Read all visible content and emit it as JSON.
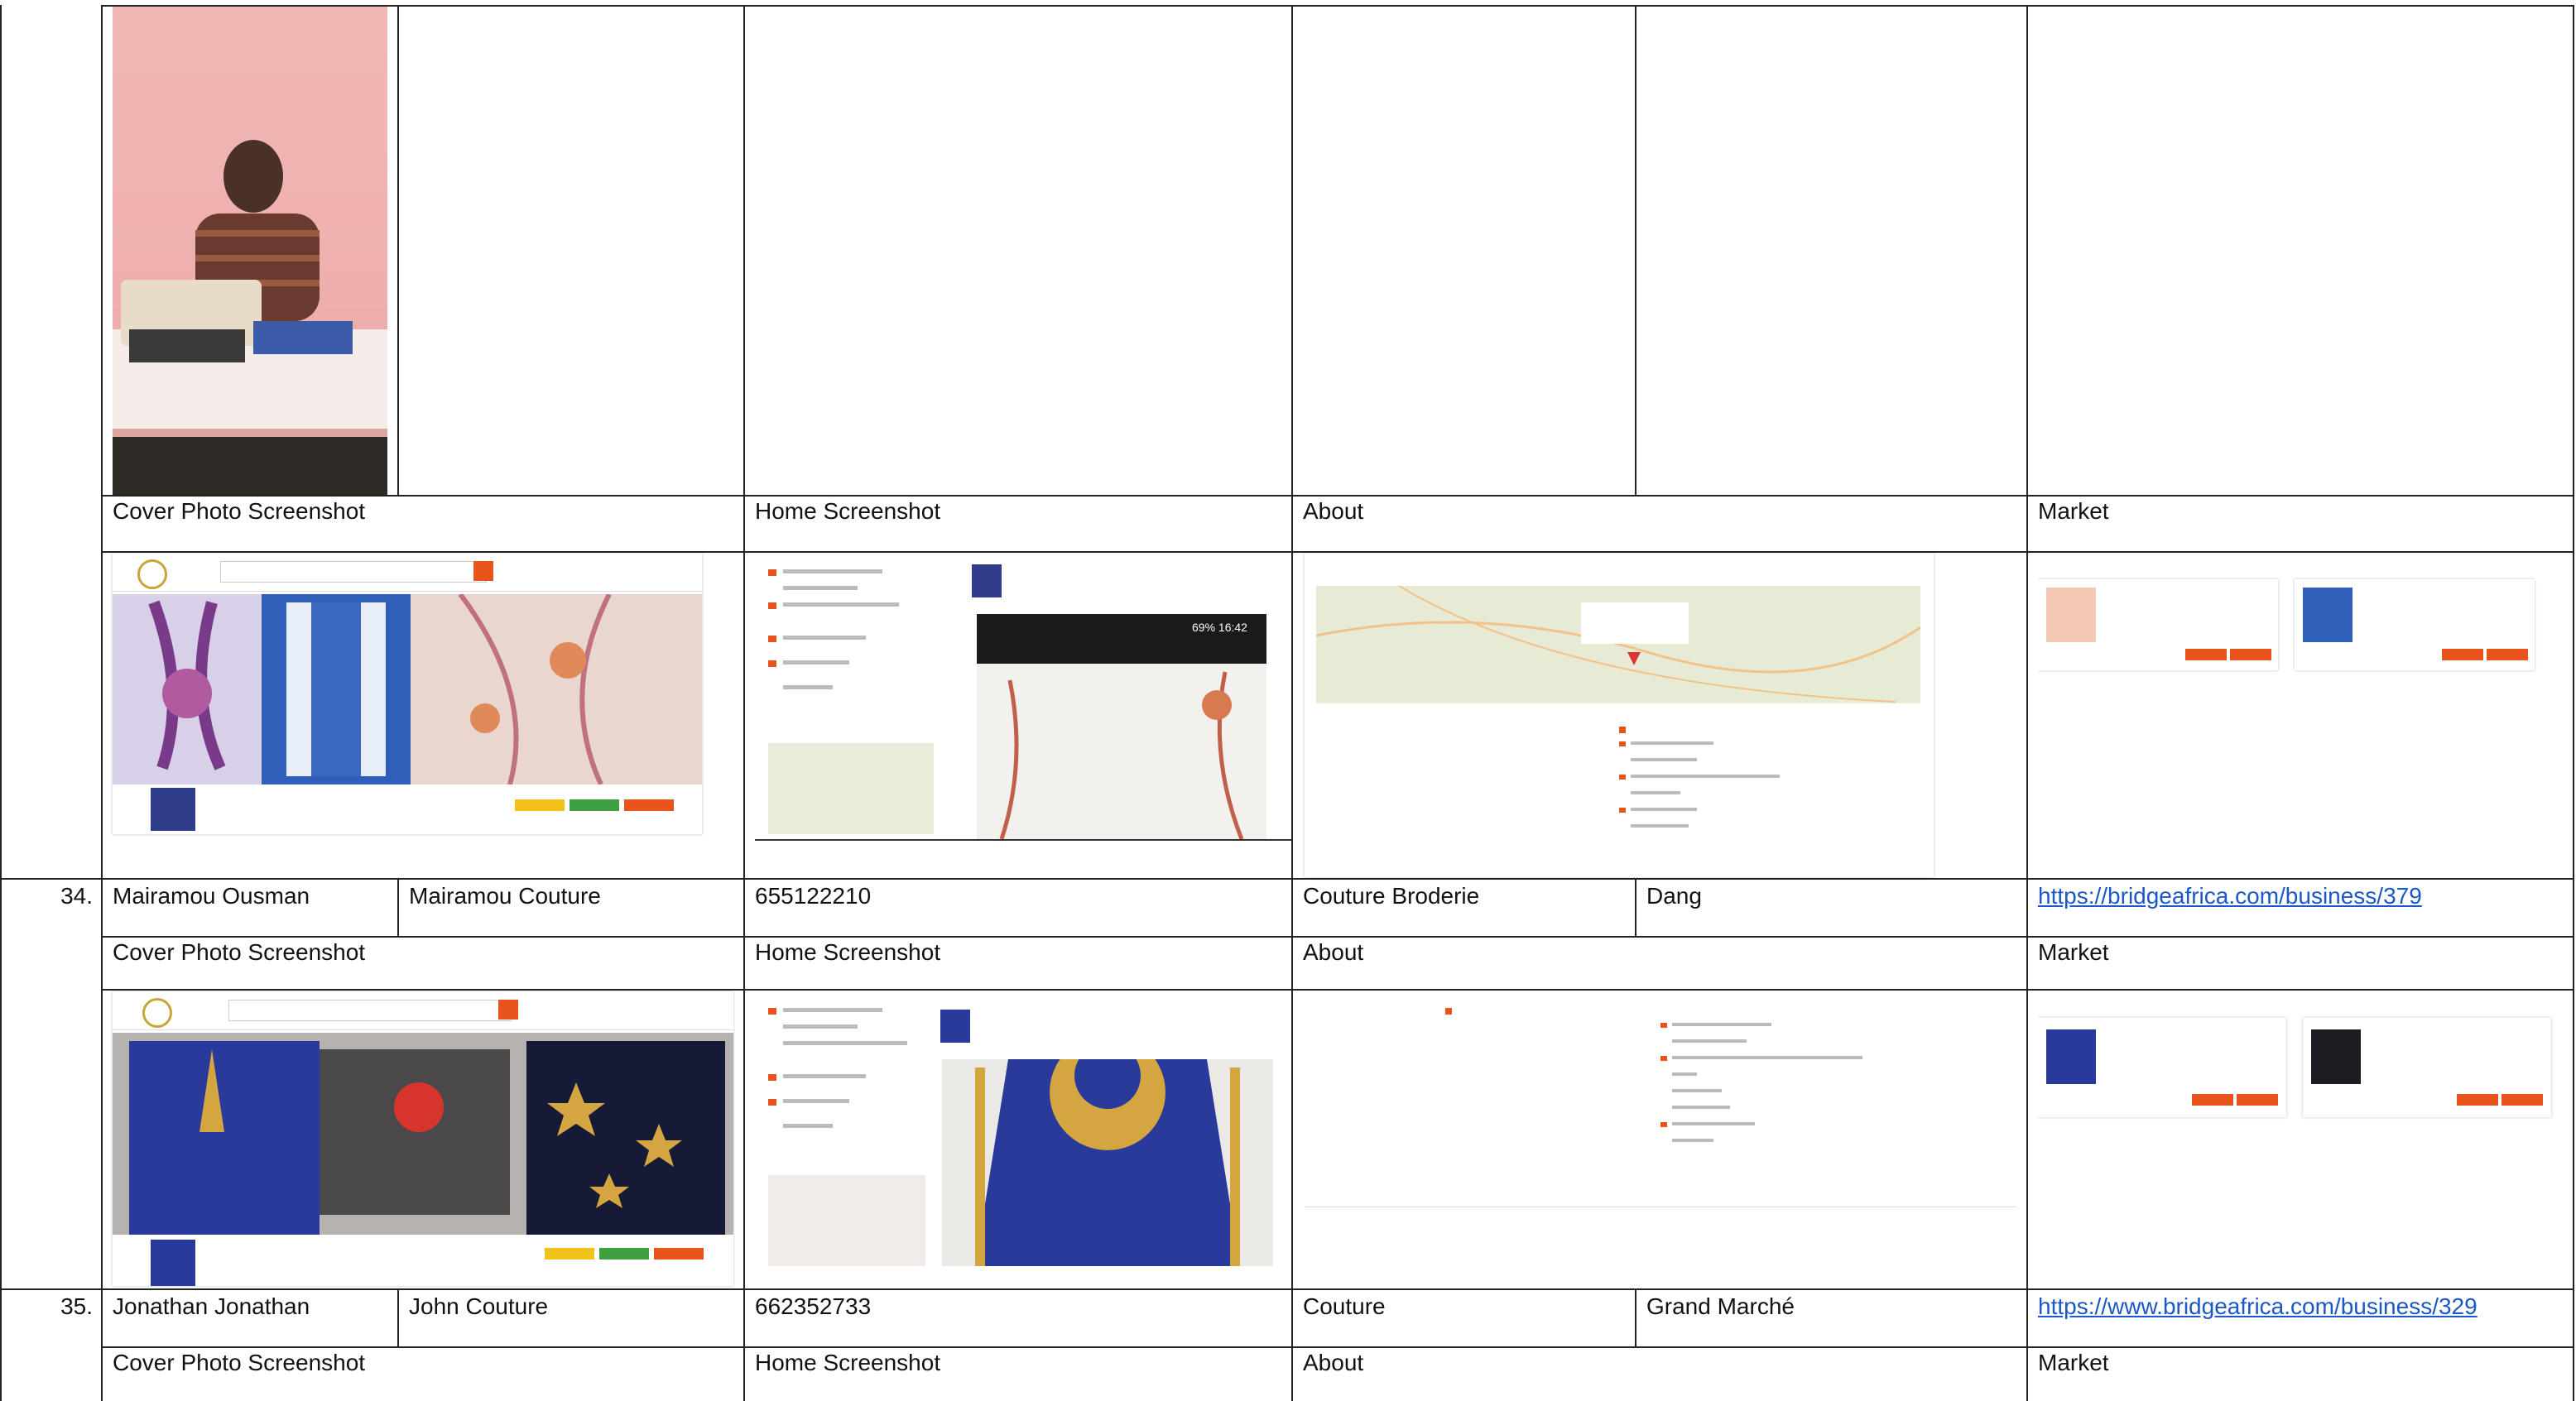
{
  "section_headers": {
    "cover": "Cover Photo Screenshot",
    "home": "Home Screenshot",
    "about": "About",
    "market": "Market"
  },
  "rows": [
    {
      "number": "34.",
      "owner": "Mairamou Ousman",
      "business": "Mairamou Couture",
      "phone": "655122210",
      "category": "Couture Broderie",
      "location": "Dang",
      "url": "https://bridgeafrica.com/business/379"
    },
    {
      "number": "35.",
      "owner": "Jonathan Jonathan",
      "business": "John Couture",
      "phone": "662352733",
      "category": "Couture",
      "location": "Grand Marché",
      "url": "https://www.bridgeafrica.com/business/329"
    }
  ],
  "phone_status": "69% 16:42",
  "colors": {
    "brand_orange": "#e8541c",
    "link_blue": "#1a57c8",
    "royal_blue": "#2a3a9a",
    "gold": "#d4a640"
  }
}
